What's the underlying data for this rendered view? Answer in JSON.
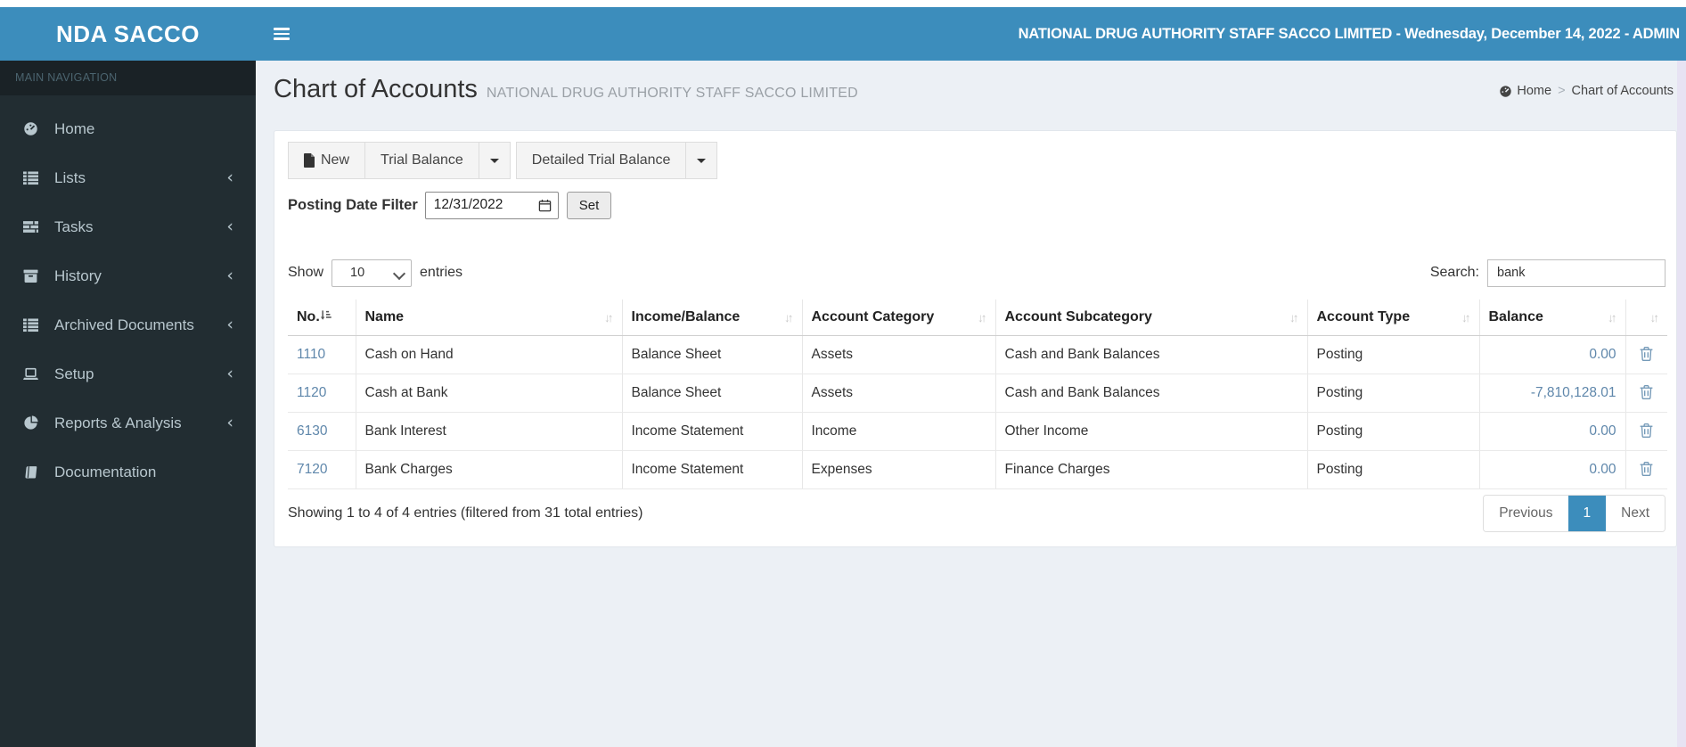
{
  "brand": {
    "logo": "NDA SACCO"
  },
  "topbar": {
    "title": "NATIONAL DRUG AUTHORITY STAFF SACCO LIMITED - Wednesday, December 14, 2022 - ADMIN"
  },
  "sidebar": {
    "section_label": "MAIN NAVIGATION",
    "items": [
      {
        "label": "Home",
        "icon": "dashboard-icon",
        "has_submenu": false
      },
      {
        "label": "Lists",
        "icon": "th-list-icon",
        "has_submenu": true
      },
      {
        "label": "Tasks",
        "icon": "tasks-icon",
        "has_submenu": true
      },
      {
        "label": "History",
        "icon": "archive-icon",
        "has_submenu": true
      },
      {
        "label": "Archived Documents",
        "icon": "th-list-icon",
        "has_submenu": true
      },
      {
        "label": "Setup",
        "icon": "laptop-icon",
        "has_submenu": true
      },
      {
        "label": "Reports & Analysis",
        "icon": "pie-chart-icon",
        "has_submenu": true
      },
      {
        "label": "Documentation",
        "icon": "book-icon",
        "has_submenu": false
      }
    ]
  },
  "page": {
    "title": "Chart of Accounts",
    "subtitle": "NATIONAL DRUG AUTHORITY STAFF SACCO LIMITED",
    "breadcrumb": {
      "home": "Home",
      "separator": ">",
      "current": "Chart of Accounts"
    }
  },
  "toolbar": {
    "new_label": "New",
    "trial_balance_label": "Trial Balance",
    "detailed_trial_balance_label": "Detailed Trial Balance"
  },
  "filter": {
    "label": "Posting Date Filter",
    "date_value": "12/31/2022",
    "set_label": "Set"
  },
  "table_controls": {
    "show_label": "Show",
    "page_length": "10",
    "entries_label": "entries",
    "search_label": "Search:",
    "search_value": "bank"
  },
  "table": {
    "columns": [
      "No.",
      "Name",
      "Income/Balance",
      "Account Category",
      "Account Subcategory",
      "Account Type",
      "Balance",
      ""
    ],
    "rows": [
      {
        "no": "1110",
        "name": "Cash on Hand",
        "income_balance": "Balance Sheet",
        "category": "Assets",
        "subcategory": "Cash and Bank Balances",
        "type": "Posting",
        "balance": "0.00"
      },
      {
        "no": "1120",
        "name": "Cash at Bank",
        "income_balance": "Balance Sheet",
        "category": "Assets",
        "subcategory": "Cash and Bank Balances",
        "type": "Posting",
        "balance": "-7,810,128.01"
      },
      {
        "no": "6130",
        "name": "Bank Interest",
        "income_balance": "Income Statement",
        "category": "Income",
        "subcategory": "Other Income",
        "type": "Posting",
        "balance": "0.00"
      },
      {
        "no": "7120",
        "name": "Bank Charges",
        "income_balance": "Income Statement",
        "category": "Expenses",
        "subcategory": "Finance Charges",
        "type": "Posting",
        "balance": "0.00"
      }
    ],
    "summary": "Showing 1 to 4 of 4 entries (filtered from 31 total entries)"
  },
  "pagination": {
    "previous": "Previous",
    "page": "1",
    "next": "Next"
  },
  "colors": {
    "navbar_blue": "#3c8dbc",
    "sidebar_dark": "#222d32",
    "sidebar_text": "#b8c7ce",
    "content_bg": "#ecf0f5",
    "link_blue": "#5f87ab",
    "active_page_blue": "#3c8dbc"
  }
}
